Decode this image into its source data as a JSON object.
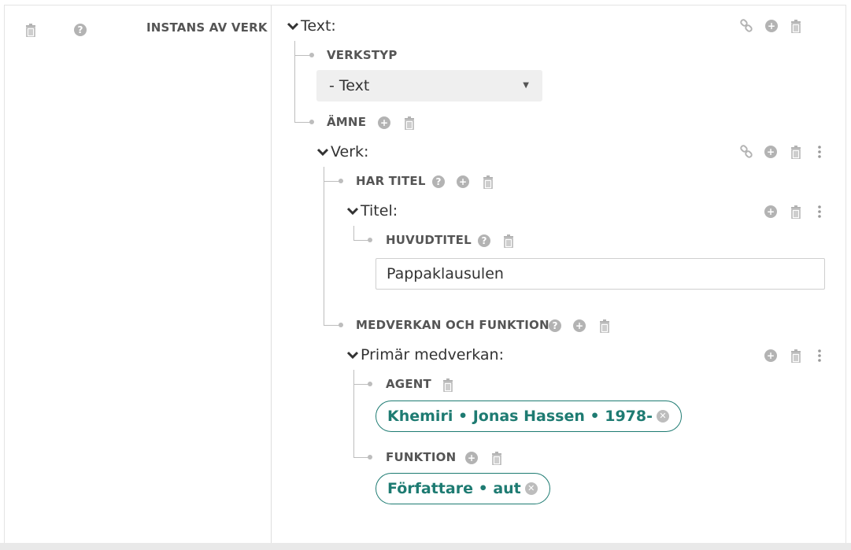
{
  "left_panel": {
    "title": "INSTANS AV VERK"
  },
  "text_block": {
    "heading": "Text:",
    "verkstyp_label": "VERKSTYP",
    "verkstyp_value": "- Text",
    "amne_label": "ÄMNE"
  },
  "verk_block": {
    "heading": "Verk:",
    "har_titel_label": "HAR TITEL",
    "titel_heading": "Titel:",
    "huvudtitel_label": "HUVUDTITEL",
    "huvudtitel_value": "Pappaklausulen",
    "medverkan_label": "MEDVERKAN OCH FUNKTION"
  },
  "primar_block": {
    "heading": "Primär medverkan:",
    "agent_label": "AGENT",
    "agent_value": "Khemiri • Jonas Hassen • 1978-",
    "funktion_label": "FUNKTION",
    "funktion_value": "Författare • aut"
  },
  "colors": {
    "accent": "#1e7b72",
    "icon_grey": "#b3b3b3",
    "label_grey": "#555555"
  },
  "icons": [
    "trash-icon",
    "help-icon",
    "link-icon",
    "add-icon",
    "more-icon",
    "chevron-down-icon",
    "remove-icon"
  ]
}
